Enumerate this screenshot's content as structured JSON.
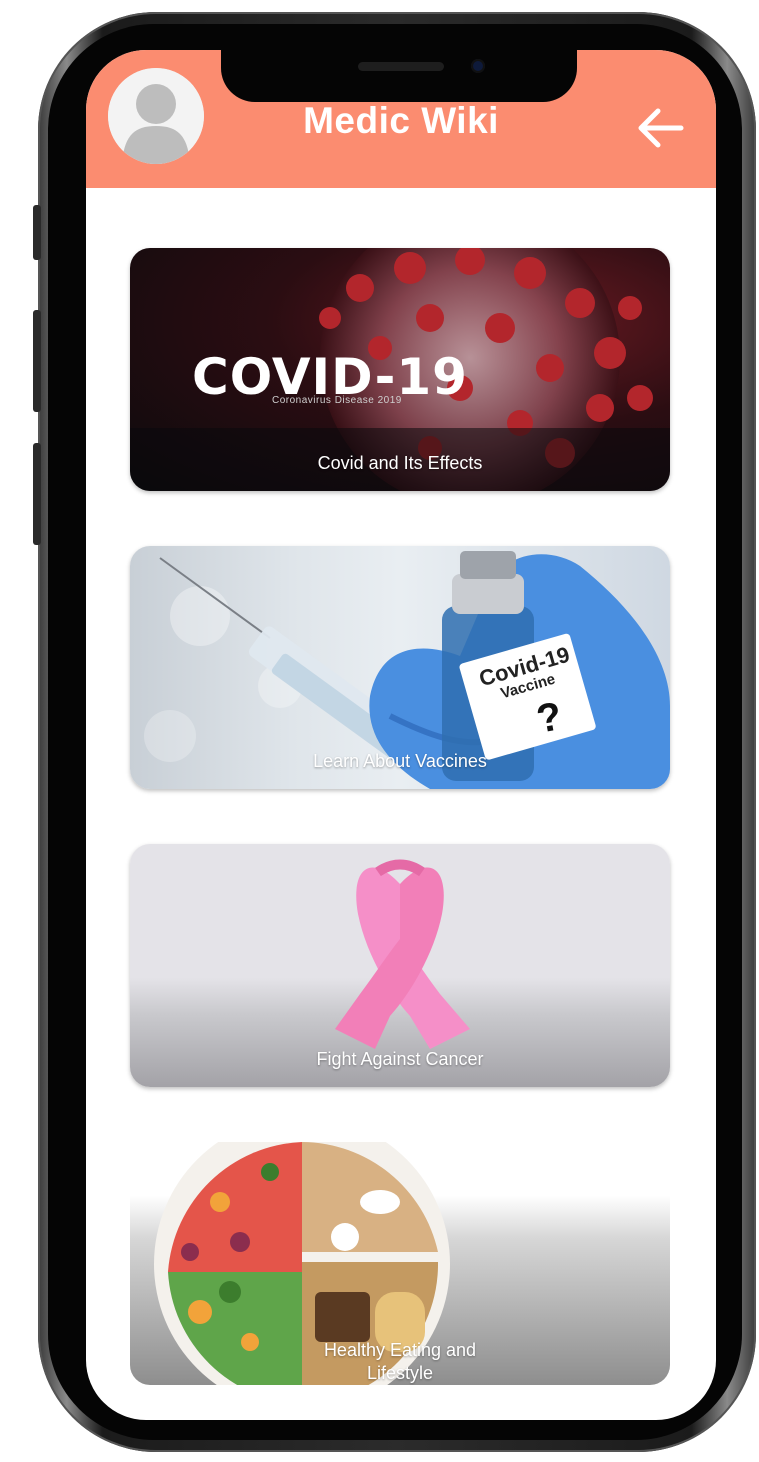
{
  "app": {
    "title": "Medic Wiki",
    "header_color": "#fb8c70"
  },
  "header": {
    "avatar_icon": "user-avatar-icon",
    "back_icon": "arrow-left-icon"
  },
  "cards": [
    {
      "label": "Covid and Its Effects",
      "image_title": "COVID-19",
      "image_subtitle": "Coronavirus Disease 2019"
    },
    {
      "label": "Learn About Vaccines",
      "vial_label_line1": "Covid-19",
      "vial_label_line2": "Vaccine",
      "vial_label_mark": "?"
    },
    {
      "label": "Fight Against Cancer",
      "ribbon_color": "#f27fb8"
    },
    {
      "label": "Healthy Eating and Lifestyle"
    }
  ]
}
